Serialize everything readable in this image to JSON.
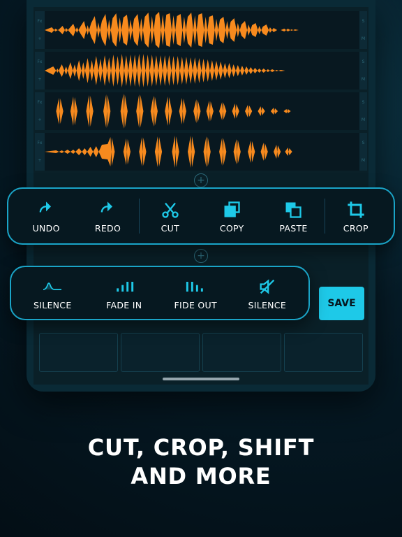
{
  "toolbar_main": {
    "undo": "UNDO",
    "redo": "REDO",
    "cut": "CUT",
    "copy": "COPY",
    "paste": "PASTE",
    "crop": "CROP"
  },
  "toolbar_sub": {
    "silence1": "SILENCE",
    "fade_in": "FADE IN",
    "fide_out": "FIDE OUT",
    "silence2": "SILENCE"
  },
  "save_label": "SAVE",
  "add_glyph": "+",
  "headline_line1": "CUT, CROP, SHIFT",
  "headline_line2": "AND MORE",
  "track_side_left": [
    "Fx",
    "+"
  ],
  "track_side_right": [
    "S",
    "M"
  ],
  "colors": {
    "accent": "#1ec9e8",
    "wave": "#f78a1e"
  }
}
